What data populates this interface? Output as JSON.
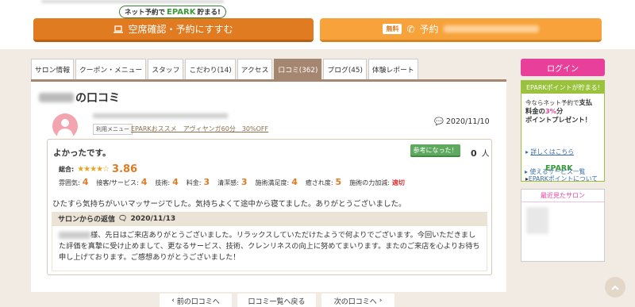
{
  "promo": {
    "pre": "ネット予約で",
    "brand": "EPARK",
    "post": "貯まる!"
  },
  "buttons": {
    "reserve": "空席確認・予約にすすむ",
    "free": "無料",
    "tel": "予約"
  },
  "tabs": [
    {
      "label": "サロン情報"
    },
    {
      "label": "クーポン・メニュー"
    },
    {
      "label": "スタッフ"
    },
    {
      "label": "こだわり(14)"
    },
    {
      "label": "アクセス"
    },
    {
      "label": "口コミ(362)",
      "active": true
    },
    {
      "label": "ブログ(45)"
    },
    {
      "label": "体験レポート"
    }
  ],
  "review": {
    "title_suffix": "の口コミ",
    "menu_tag": "利用メニュー",
    "menu_link": "EPARKおススメ　アヴィヤンガ60分　30%OFF",
    "date": "2020/11/10",
    "headline": "よかったです。",
    "helpful_button": "参考になった！",
    "helpful_count": "0",
    "helpful_unit": "人",
    "overall_label": "総合:",
    "overall_score": "3.86",
    "overall_rating": 3.86,
    "categories": [
      {
        "label": "雰囲気:",
        "value": "4"
      },
      {
        "label": "接客/サービス:",
        "value": "4"
      },
      {
        "label": "技術:",
        "value": "4"
      },
      {
        "label": "料金:",
        "value": "3"
      },
      {
        "label": "清潔感:",
        "value": "3"
      },
      {
        "label": "施術満足度:",
        "value": "4"
      },
      {
        "label": "癒され度:",
        "value": "5"
      },
      {
        "label": "施術の力加減:",
        "value": "適切"
      }
    ],
    "body": "ひたすら気持ちがいいマッサージでした。気持ちよくて途中から寝てました。ありがとうございました。",
    "reply_label": "サロンからの返信",
    "reply_date": "2020/11/13",
    "reply_text": "様、先日はご来店ありがとうございました。リラックスしていただけたようで何よりでございます。今回いただきました評価を真摯に受け止めまして、更なるサービス、技術、クレンリネスの向上に努めてまいります。またのご来店を心よりお待ち申し上げております。ご感想ありがとうございました！"
  },
  "pager": {
    "prev": "前の口コミへ",
    "list": "口コミ一覧へ戻る",
    "next": "次の口コミへ"
  },
  "sidebar": {
    "login": "ログイン",
    "points_header": "EPARKポイントが貯まる!",
    "points_line1": "今ならネット予約で",
    "points_line2a": "支払",
    "points_line2b": "料金の",
    "points_pct": "3%",
    "points_line2c": "分",
    "points_line3": "ポイントプレゼント！",
    "detail_link": "詳しくはこちら",
    "logo": "EPARK",
    "about_link": "EPARKポイントについて",
    "services_link": "使えるサービス一覧",
    "recent_header": "最近見たサロン"
  },
  "colors": {
    "accent": "#e07b22",
    "tab_active": "#a58670",
    "login": "#e8409a",
    "points": "#9ac23c"
  }
}
